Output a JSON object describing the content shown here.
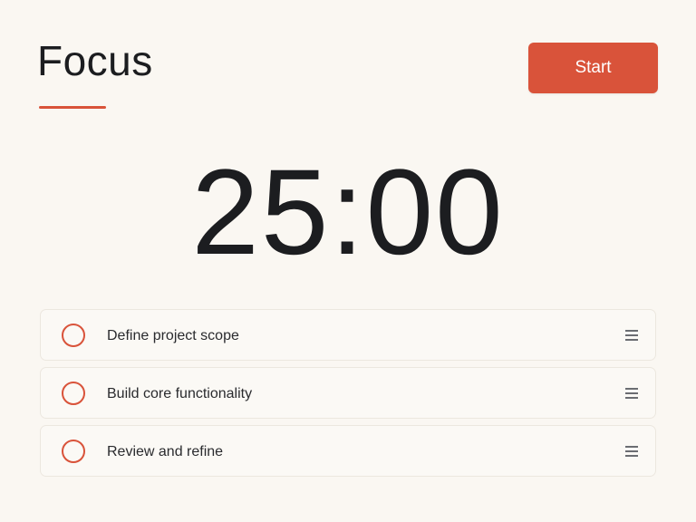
{
  "header": {
    "title": "Focus",
    "start_label": "Start"
  },
  "timer": {
    "display": "25:00"
  },
  "tasks": [
    {
      "label": "Define project scope",
      "completed": false
    },
    {
      "label": "Build core functionality",
      "completed": false
    },
    {
      "label": "Review and refine",
      "completed": false
    }
  ],
  "colors": {
    "accent": "#d9533a",
    "background": "#faf7f2",
    "text": "#1c1d20"
  },
  "icons": {
    "task_check": "circle-outline-icon",
    "drag": "drag-handle-icon"
  }
}
